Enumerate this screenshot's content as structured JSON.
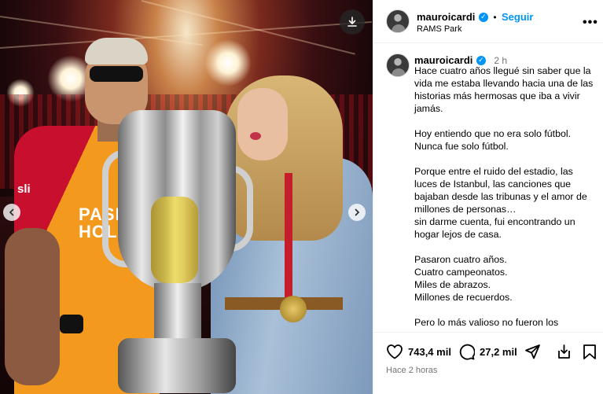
{
  "photo": {
    "jersey_sponsor": "PASHA\nHOLD",
    "jersey_side_text": "sli",
    "icons": {
      "download": "download-icon",
      "nav_left": "chevron-left-icon",
      "nav_right": "chevron-right-icon"
    }
  },
  "header": {
    "username": "mauroicardi",
    "separator": "•",
    "follow_label": "Seguir",
    "location": "RAMS Park",
    "more_label": "•••"
  },
  "caption": {
    "username": "mauroicardi",
    "time_ago": "2 h",
    "text": "Hace cuatro años llegué sin saber que la vida me estaba llevando hacia una de las historias más hermosas que iba a vivir jamás.\n\nHoy entiendo que no era solo fútbol.\nNunca fue solo fútbol.\n\nPorque entre el ruido del estadio, las luces de Istanbul, las canciones que bajaban desde las tribunas y el amor de millones de personas…\nsin darme cuenta, fui encontrando un hogar lejos de casa.\n\nPasaron cuatro años.\nCuatro campeonatos.\nMiles de abrazos.\nMillones de recuerdos.\n\nPero lo más valioso no fueron los"
  },
  "actions": {
    "likes": "743,4 mil",
    "comments": "27,2 mil",
    "posted": "Hace 2 horas"
  },
  "colors": {
    "accent": "#0095f6",
    "muted": "#737373",
    "border": "#efefef"
  }
}
